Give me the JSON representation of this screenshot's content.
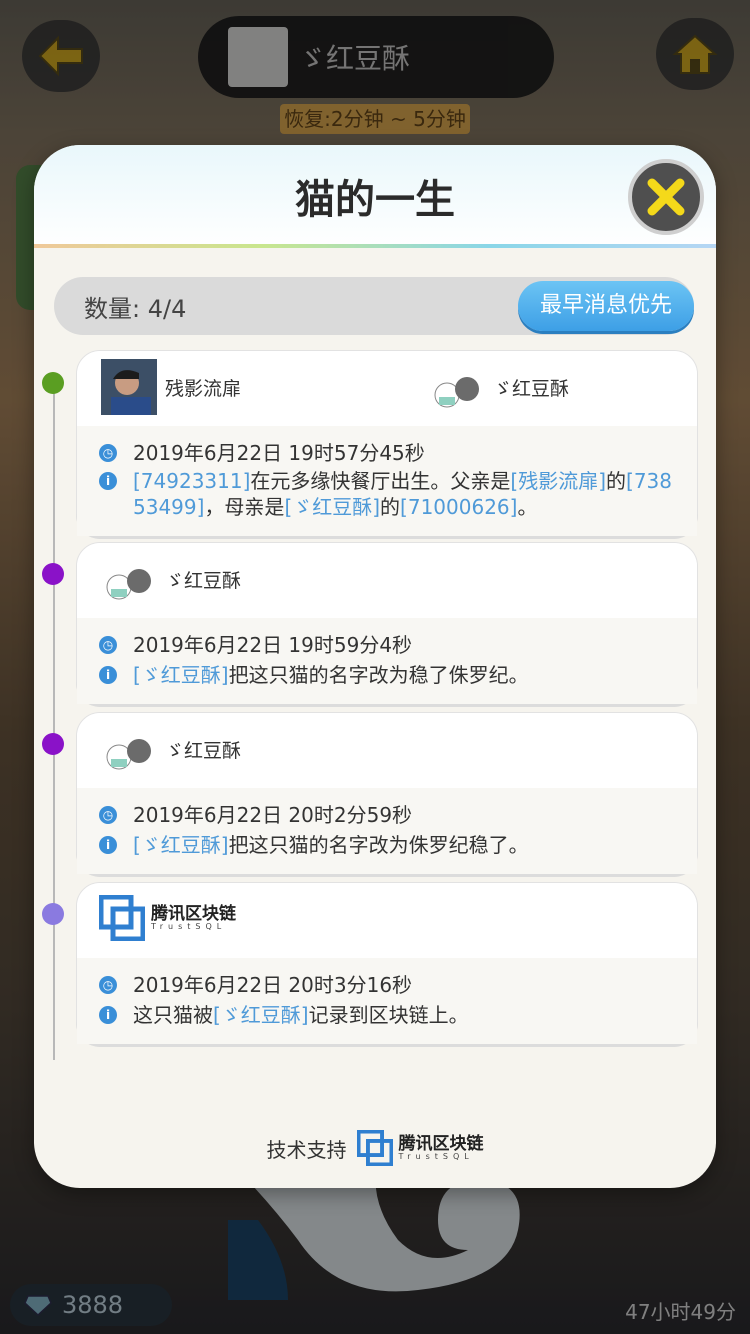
{
  "hud": {
    "title_name": "ゞ红豆酥",
    "subtitle": "恢复:2分钟 ~ 5分钟",
    "coins": "3888",
    "timer": "47小时49分"
  },
  "modal": {
    "title": "猫的一生",
    "count_label": "数量: 4/4",
    "sort_button": "最早消息优先",
    "footer_text": "技术支持",
    "brand_name": "腾讯区块链",
    "brand_sub": "TrustSQL"
  },
  "events": [
    {
      "dot_color": "#5a9e22",
      "parties": [
        "残影流扉",
        "ゞ红豆酥"
      ],
      "time": "2019年6月22日 19时57分45秒",
      "info": {
        "l1": "[74923311]",
        "t1": "在元多缘快餐厅出生。父亲是",
        "l2": "[残影流扉]",
        "t2": "的",
        "l3": "[738",
        "l3b": "53499]",
        "t3": "，母亲是",
        "l4": "[ゞ红豆酥]",
        "t4": "的",
        "l5": "[71000626]",
        "t5": "。"
      }
    },
    {
      "dot_color": "#8a12c8",
      "parties": [
        "ゞ红豆酥"
      ],
      "time": "2019年6月22日 19时59分4秒",
      "info": {
        "l1": "[ゞ红豆酥]",
        "t1": "把这只猫的名字改为稳了侏罗纪。"
      }
    },
    {
      "dot_color": "#8a12c8",
      "parties": [
        "ゞ红豆酥"
      ],
      "time": "2019年6月22日 20时2分59秒",
      "info": {
        "l1": "[ゞ红豆酥]",
        "t1": "把这只猫的名字改为侏罗纪稳了。"
      }
    },
    {
      "dot_color": "#8a7ae0",
      "parties": [
        "腾讯区块链",
        "TrustSQL"
      ],
      "time": "2019年6月22日 20时3分16秒",
      "info": {
        "t0": "这只猫被",
        "l1": "[ゞ红豆酥]",
        "t1": "记录到区块链上。"
      }
    }
  ]
}
